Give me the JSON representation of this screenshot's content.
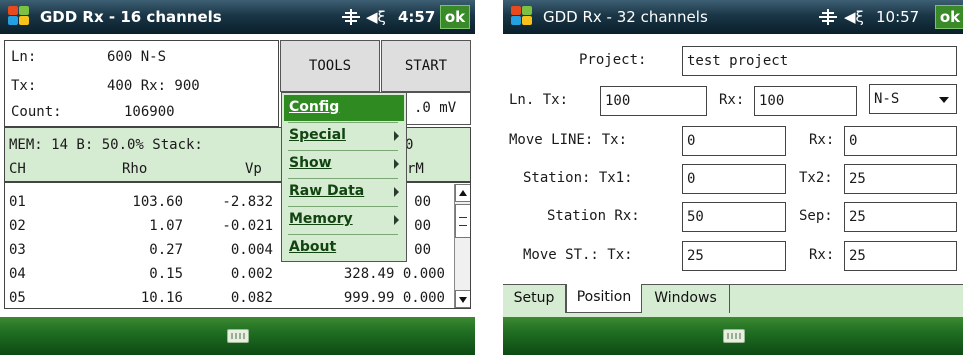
{
  "phoneA": {
    "title": "GDD Rx - 16 channels",
    "time": "4:57",
    "ok_label": "ok",
    "info": {
      "ln_label": "Ln:",
      "ln_value": "600 N-S",
      "tx_label": "Tx:",
      "tx_value": "400 Rx: 900",
      "count_label": "Count:",
      "count_value": "106900",
      "mv_value": ".0 mV"
    },
    "buttons": {
      "tools": "TOOLS",
      "start": "START"
    },
    "status_line": "MEM: 14 B: 50.0% Stack:",
    "status_tail": "0",
    "headers": {
      "ch": "CH",
      "rho": "Rho",
      "vp": "Vp",
      "rm": "rM"
    },
    "rows": [
      {
        "ch": "01",
        "rho": "103.60",
        "vp": "-2.832",
        "tail": "00"
      },
      {
        "ch": "02",
        "rho": "1.07",
        "vp": "-0.021",
        "tail": "00"
      },
      {
        "ch": "03",
        "rho": "0.27",
        "vp": "0.004",
        "tail": "00"
      },
      {
        "ch": "04",
        "rho": "0.15",
        "vp": "0.002",
        "tail": "328.49 0.000"
      },
      {
        "ch": "05",
        "rho": "10.16",
        "vp": "0.082",
        "tail": "999.99 0.000"
      }
    ],
    "menu": {
      "items": [
        {
          "label": "Config",
          "selected": true,
          "submenu": false
        },
        {
          "label": "Special",
          "selected": false,
          "submenu": true
        },
        {
          "label": "Show",
          "selected": false,
          "submenu": true
        },
        {
          "label": "Raw Data",
          "selected": false,
          "submenu": true
        },
        {
          "label": "Memory",
          "selected": false,
          "submenu": true
        },
        {
          "label": "About",
          "selected": false,
          "submenu": false
        }
      ]
    }
  },
  "phoneB": {
    "title": "GDD Rx - 32 channels",
    "time": "10:57",
    "ok_label": "ok",
    "form": {
      "project_label": "Project:",
      "project_value": "test project",
      "ln_tx_label": "Ln. Tx:",
      "ln_tx_value": "100",
      "rx_label": "Rx:",
      "rx_value": "100",
      "direction_value": "N-S",
      "move_line_label": "Move LINE: Tx:",
      "move_line_tx": "0",
      "move_line_rx_label": "Rx:",
      "move_line_rx": "0",
      "station_tx1_label": "Station: Tx1:",
      "station_tx1": "0",
      "tx2_label": "Tx2:",
      "tx2": "25",
      "station_rx_label": "Station Rx:",
      "station_rx": "50",
      "sep_label": "Sep:",
      "sep": "25",
      "move_st_label": "Move ST.: Tx:",
      "move_st_tx": "25",
      "move_st_rx_label": "Rx:",
      "move_st_rx": "25"
    },
    "tabs": [
      "Setup",
      "Position",
      "Windows"
    ],
    "active_tab": "Position"
  },
  "colors": {
    "accent_green": "#2f8a22",
    "panel_green": "#d6ecd2",
    "titlebar_dark": "#1a3646"
  },
  "icons": [
    "windows-start-icon",
    "signal-icon",
    "volume-icon",
    "keyboard-icon",
    "submenu-arrow-icon",
    "dropdown-arrow-icon"
  ]
}
